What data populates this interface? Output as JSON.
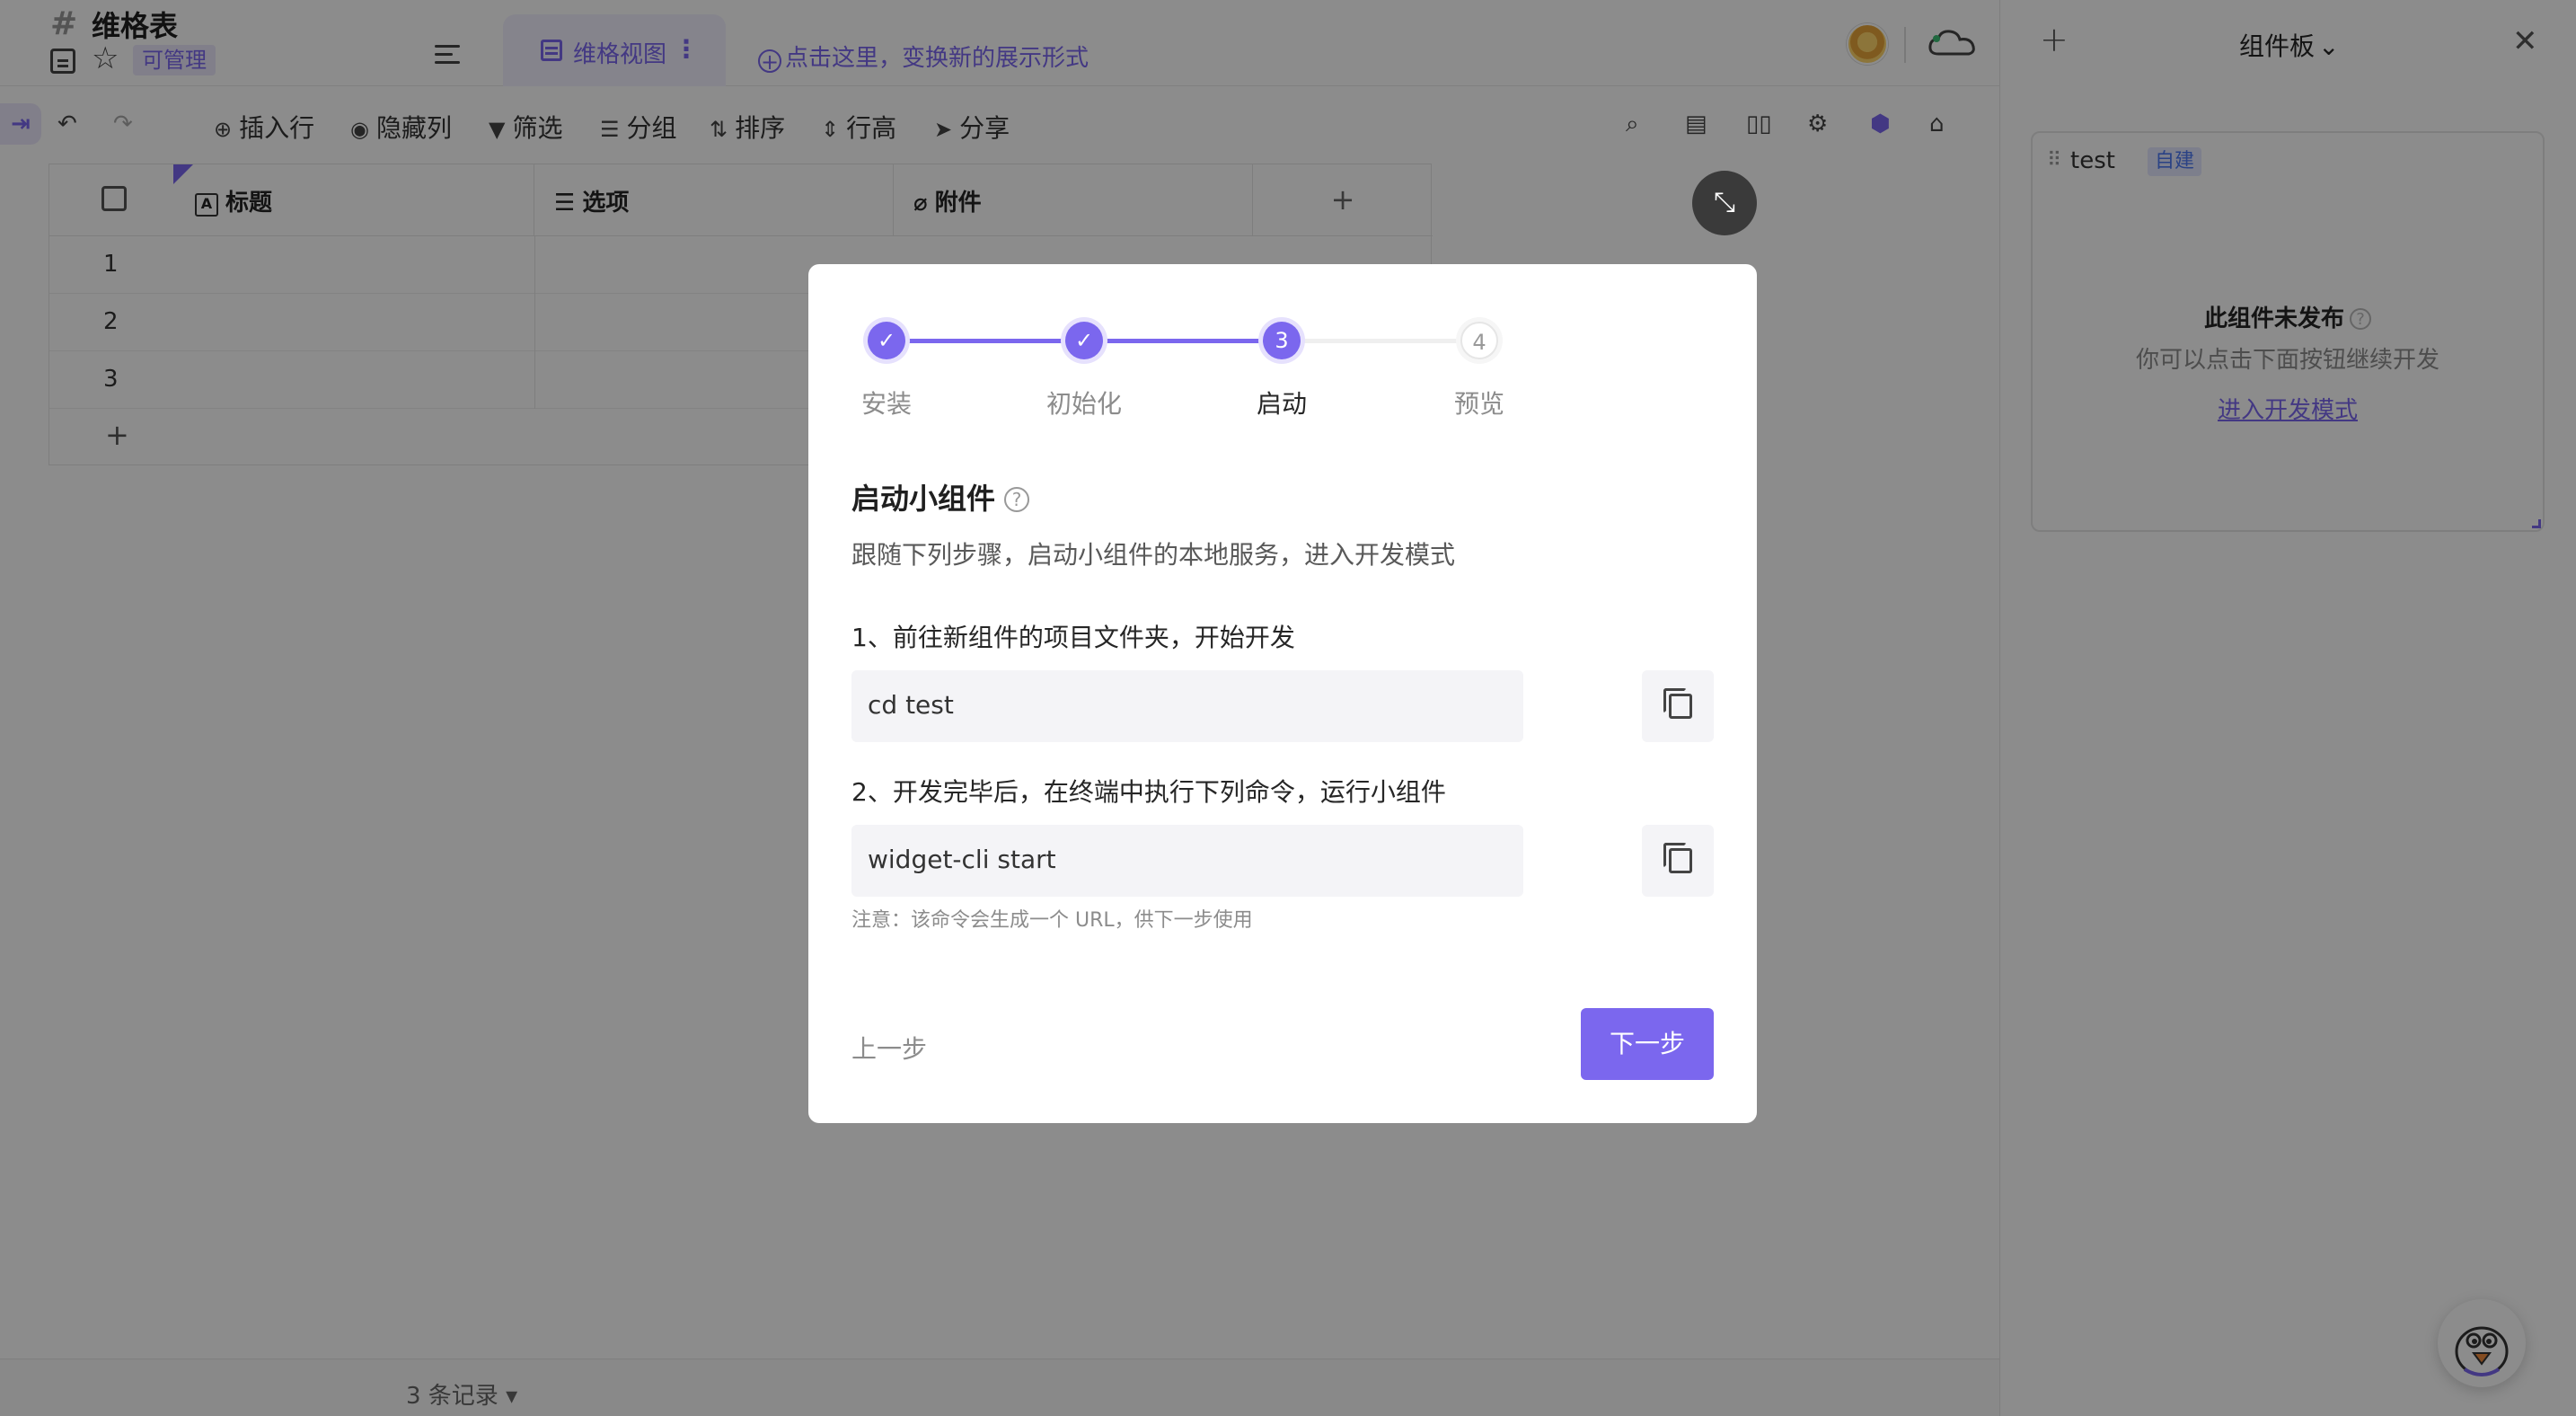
{
  "header": {
    "sheet_title": "维格表",
    "permission_badge": "可管理",
    "view_tab_label": "维格视图",
    "view_tab_more": "⋮",
    "add_view_hint": "点击这里，变换新的展示形式"
  },
  "toolbar": {
    "insert_row": "插入行",
    "hide_column": "隐藏列",
    "filter": "筛选",
    "group": "分组",
    "sort": "排序",
    "row_height": "行高",
    "share": "分享"
  },
  "grid": {
    "columns": [
      "标题",
      "选项",
      "附件"
    ],
    "column_icons": [
      "A",
      "☰",
      "⌀"
    ],
    "add_column": "+",
    "rows": [
      "1",
      "2",
      "3"
    ],
    "add_row": "+"
  },
  "footer": {
    "record_count": "3 条记录 ▾"
  },
  "panel": {
    "add": "+",
    "title": "组件板",
    "title_chevron": "⌄",
    "close": "✕",
    "widget_name": "test",
    "widget_badge": "自建",
    "unpublished_title": "此组件未发布",
    "unpublished_desc": "你可以点击下面按钮继续开发",
    "dev_mode_link": "进入开发模式"
  },
  "modal": {
    "steps": [
      {
        "num": "✓",
        "label": "安装",
        "state": "done"
      },
      {
        "num": "✓",
        "label": "初始化",
        "state": "done"
      },
      {
        "num": "3",
        "label": "启动",
        "state": "active"
      },
      {
        "num": "4",
        "label": "预览",
        "state": "todo"
      }
    ],
    "title": "启动小组件",
    "help": "?",
    "description": "跟随下列步骤，启动小组件的本地服务，进入开发模式",
    "step1_label": "1、前往新组件的项目文件夹，开始开发",
    "step1_code": "cd test",
    "step2_label": "2、开发完毕后，在终端中执行下列命令，运行小组件",
    "step2_code": "widget-cli start",
    "note": "注意：该命令会生成一个 URL，供下一步使用",
    "prev_button": "上一步",
    "next_button": "下一步"
  },
  "colors": {
    "accent": "#7B67EE",
    "overlay": "rgba(0,0,0,0.45)",
    "badge_blue": "#4D78F2"
  }
}
